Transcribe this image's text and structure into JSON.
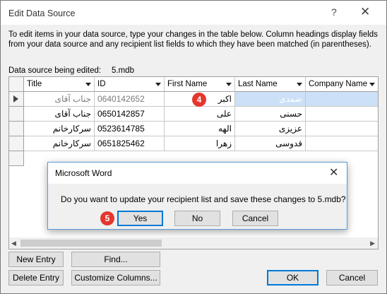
{
  "dialog": {
    "title": "Edit Data Source",
    "help_glyph": "?",
    "close_glyph": "✕",
    "instructions": "To edit items in your data source, type your changes in the table below. Column headings display fields from your data source and any recipient list fields to which they have been matched (in parentheses).",
    "data_source_label": "Data source being edited:",
    "data_source_value": "5.mdb"
  },
  "table": {
    "columns": [
      "Title",
      "ID",
      "First Name",
      "Last Name",
      "Company Name"
    ],
    "rows": [
      [
        "جناب آقای",
        "0640142652",
        "اکبر",
        "صمدی",
        ""
      ],
      [
        "جناب آقای",
        "0650142857",
        "علی",
        "حسنی",
        ""
      ],
      [
        "سرکارخانم",
        "0523614785",
        "الهه",
        "عزیزی",
        ""
      ],
      [
        "سرکارخانم",
        "0651825462",
        "زهرا",
        "قدوسی",
        ""
      ]
    ],
    "selected_row": 0
  },
  "badges": {
    "step4": "4",
    "step5": "5"
  },
  "buttons": {
    "new_entry": "New Entry",
    "find": "Find...",
    "delete_entry": "Delete Entry",
    "customize_columns": "Customize Columns...",
    "ok": "OK",
    "cancel": "Cancel"
  },
  "modal": {
    "title": "Microsoft Word",
    "close_glyph": "✕",
    "message": "Do you want to update your recipient list and save these changes to 5.mdb?",
    "yes": "Yes",
    "no": "No",
    "cancel": "Cancel"
  },
  "colors": {
    "accent": "#0078d7",
    "badge": "#e5362d",
    "highlight": "#cce0f7"
  }
}
